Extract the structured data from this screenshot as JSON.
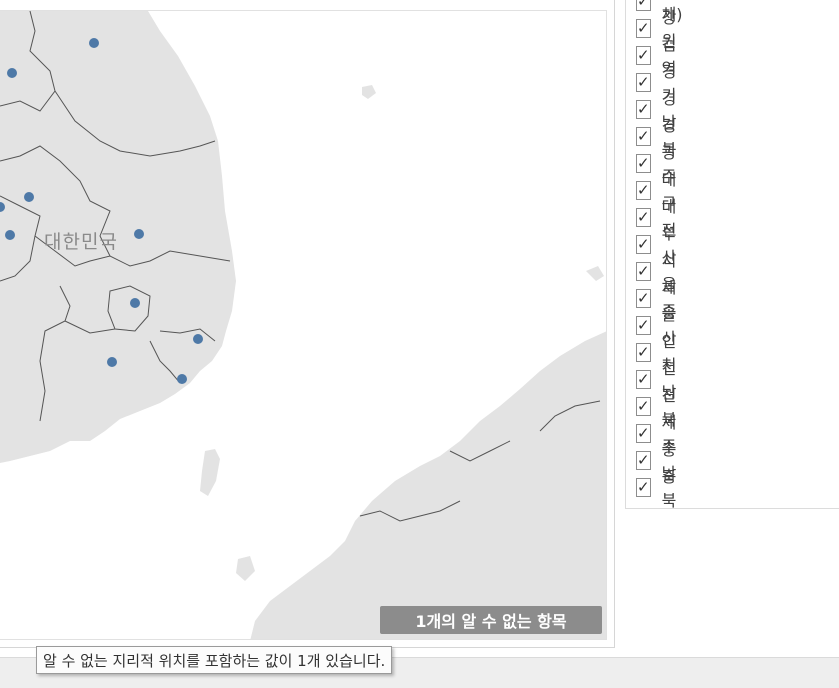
{
  "map": {
    "country_label": "대한민국",
    "unknown_badge": "1개의 알 수 없는 항목",
    "marker_color": "#4e79a7",
    "land_color": "#e3e3e3",
    "border_color": "#555555"
  },
  "filter": {
    "items": [
      {
        "label": "(전체)",
        "checked": true
      },
      {
        "label": "강원",
        "checked": true
      },
      {
        "label": "검역",
        "checked": true
      },
      {
        "label": "경기",
        "checked": true
      },
      {
        "label": "경남",
        "checked": true
      },
      {
        "label": "경북",
        "checked": true
      },
      {
        "label": "광주",
        "checked": true
      },
      {
        "label": "대구",
        "checked": true
      },
      {
        "label": "대전",
        "checked": true
      },
      {
        "label": "부산",
        "checked": true
      },
      {
        "label": "서울",
        "checked": true
      },
      {
        "label": "세종",
        "checked": true
      },
      {
        "label": "울산",
        "checked": true
      },
      {
        "label": "인천",
        "checked": true
      },
      {
        "label": "전남",
        "checked": true
      },
      {
        "label": "전북",
        "checked": true
      },
      {
        "label": "제주",
        "checked": true
      },
      {
        "label": "충남",
        "checked": true
      },
      {
        "label": "충북",
        "checked": true
      }
    ],
    "check_glyph": "✓"
  },
  "tooltip": {
    "text": "알 수 없는 지리적 위치를 포함하는 값이 1개 있습니다."
  }
}
